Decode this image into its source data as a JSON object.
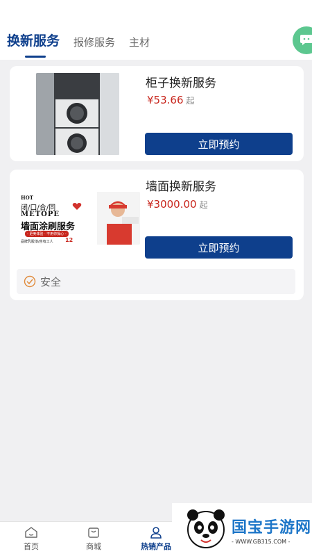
{
  "tabs": [
    {
      "label": "换新服务",
      "active": true
    },
    {
      "label": "报修服务",
      "active": false
    },
    {
      "label": "主材",
      "active": false
    }
  ],
  "services": [
    {
      "title": "柜子换新服务",
      "price": "¥53.66",
      "price_suffix": "起",
      "button": "立即预约",
      "image_icon": "washer-cabinet-photo"
    },
    {
      "title": "墙面换新服务",
      "price": "¥3000.00",
      "price_suffix": "起",
      "button": "立即预约",
      "image_icon": "wall-painting-poster",
      "poster": {
        "hot": "HOT",
        "line1": "闭/口/合/同",
        "brand": "METOPE",
        "headline": "墙面涂刷服务",
        "tagline": "- 更美体验 · 不用你操心 -",
        "footer": "品牌乳胶漆/自有工人",
        "num": "12"
      },
      "safety_label": "安全"
    }
  ],
  "nav": [
    {
      "label": "首页",
      "icon": "home-icon",
      "active": false
    },
    {
      "label": "商城",
      "icon": "shop-bag-icon",
      "active": false
    },
    {
      "label": "热销产品",
      "icon": "user-icon",
      "active": true
    }
  ],
  "watermark": {
    "title": "国宝手游网",
    "url": "- WWW.GB315.COM -"
  },
  "colors": {
    "primary": "#0e3f8c",
    "price": "#c8261d",
    "background": "#f0f0f2"
  }
}
